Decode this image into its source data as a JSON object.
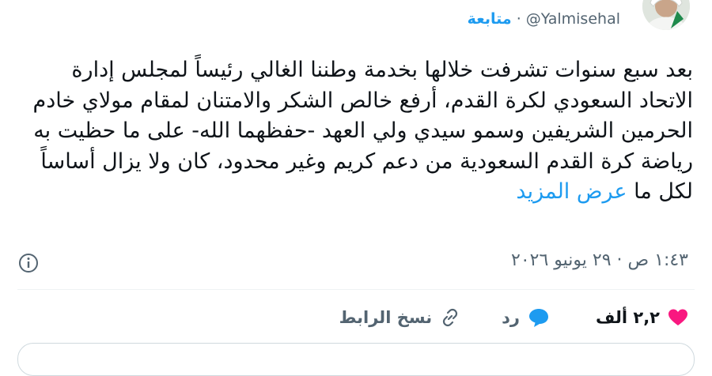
{
  "author": {
    "handle": "@Yalmisehal",
    "follow_label": "متابعة",
    "separator": "·"
  },
  "tweet": {
    "text": "بعد سبع سنوات تشرفت خلالها بخدمة وطننا الغالي رئيساً لمجلس إدارة الاتحاد السعودي لكرة القدم، أرفع خالص الشكر والامتنان لمقام مولاي خادم الحرمين الشريفين وسمو سيدي ولي العهد -حفظهما الله- على ما حظيت به رياضة كرة القدم السعودية من دعم كريم وغير محدود، كان ولا يزال أساساً لكل ما",
    "show_more": "عرض المزيد",
    "timestamp": "١:٤٣ ص · ٢٩ يونيو ٢٠٢٦"
  },
  "actions": {
    "likes_count": "٢,٢ ألف",
    "reply_label": "رد",
    "copy_link_label": "نسخ الرابط"
  },
  "colors": {
    "accent": "#1d9bf0",
    "like": "#f91880",
    "muted": "#536471"
  }
}
